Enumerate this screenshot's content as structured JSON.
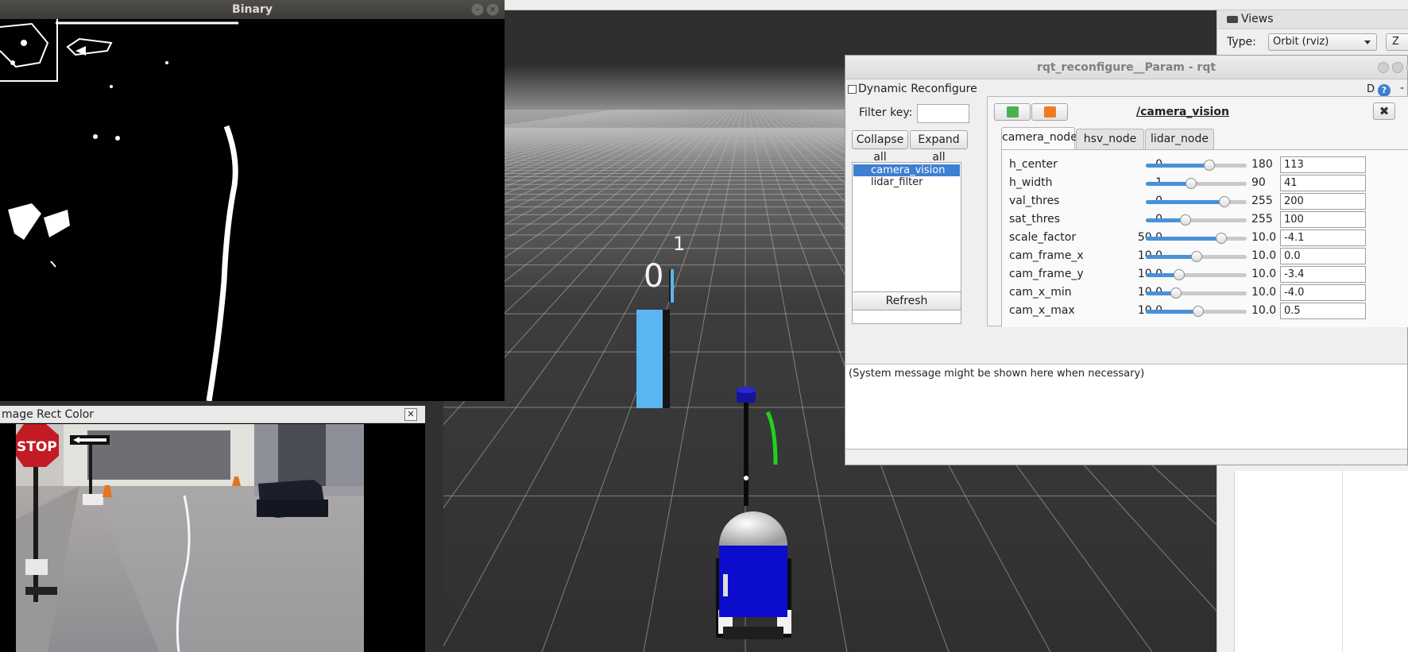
{
  "binary_window": {
    "title": "Binary"
  },
  "image_window": {
    "title": "mage Rect Color",
    "stop_sign": "STOP"
  },
  "rviz": {
    "marker_labels": [
      "1",
      "0"
    ],
    "views": {
      "title": "Views",
      "type_label": "Type:",
      "type_value": "Orbit (rviz)",
      "zero_label": "Z"
    }
  },
  "rqt": {
    "title": "rqt_reconfigure__Param - rqt",
    "plugin_title": "Dynamic Reconfigure",
    "help_d": "D",
    "help_q": "?",
    "dash": "-",
    "filter_label": "Filter key:",
    "filter_value": "",
    "collapse_all": "Collapse all",
    "expand_all": "Expand all",
    "nodes": [
      {
        "label": "camera_vision",
        "selected": true
      },
      {
        "label": "lidar_filter",
        "selected": false
      }
    ],
    "refresh": "Refresh",
    "namespace": "/camera_vision",
    "close_icon": "✖",
    "tabs": [
      {
        "label": "camera_node",
        "active": true
      },
      {
        "label": "hsv_node",
        "active": false
      },
      {
        "label": "lidar_node",
        "active": false
      }
    ],
    "params": [
      {
        "name": "h_center",
        "min": "0",
        "max": "180",
        "value": "113",
        "level": 0.63
      },
      {
        "name": "h_width",
        "min": "1",
        "max": "90",
        "value": "41",
        "level": 0.45
      },
      {
        "name": "val_thres",
        "min": "0",
        "max": "255",
        "value": "200",
        "level": 0.78
      },
      {
        "name": "sat_thres",
        "min": "0",
        "max": "255",
        "value": "100",
        "level": 0.39
      },
      {
        "name": "scale_factor",
        "min": "50.0",
        "max": "10.0",
        "value": "-4.1",
        "level": 0.75
      },
      {
        "name": "cam_frame_x",
        "min": "10.0",
        "max": "10.0",
        "value": "0.0",
        "level": 0.5
      },
      {
        "name": "cam_frame_y",
        "min": "10.0",
        "max": "10.0",
        "value": "-3.4",
        "level": 0.33
      },
      {
        "name": "cam_x_min",
        "min": "10.0",
        "max": "10.0",
        "value": "-4.0",
        "level": 0.3
      },
      {
        "name": "cam_x_max",
        "min": "10.0",
        "max": "10.0",
        "value": "0.5",
        "level": 0.52
      }
    ],
    "system_message": "(System message might be shown here when necessary)"
  }
}
